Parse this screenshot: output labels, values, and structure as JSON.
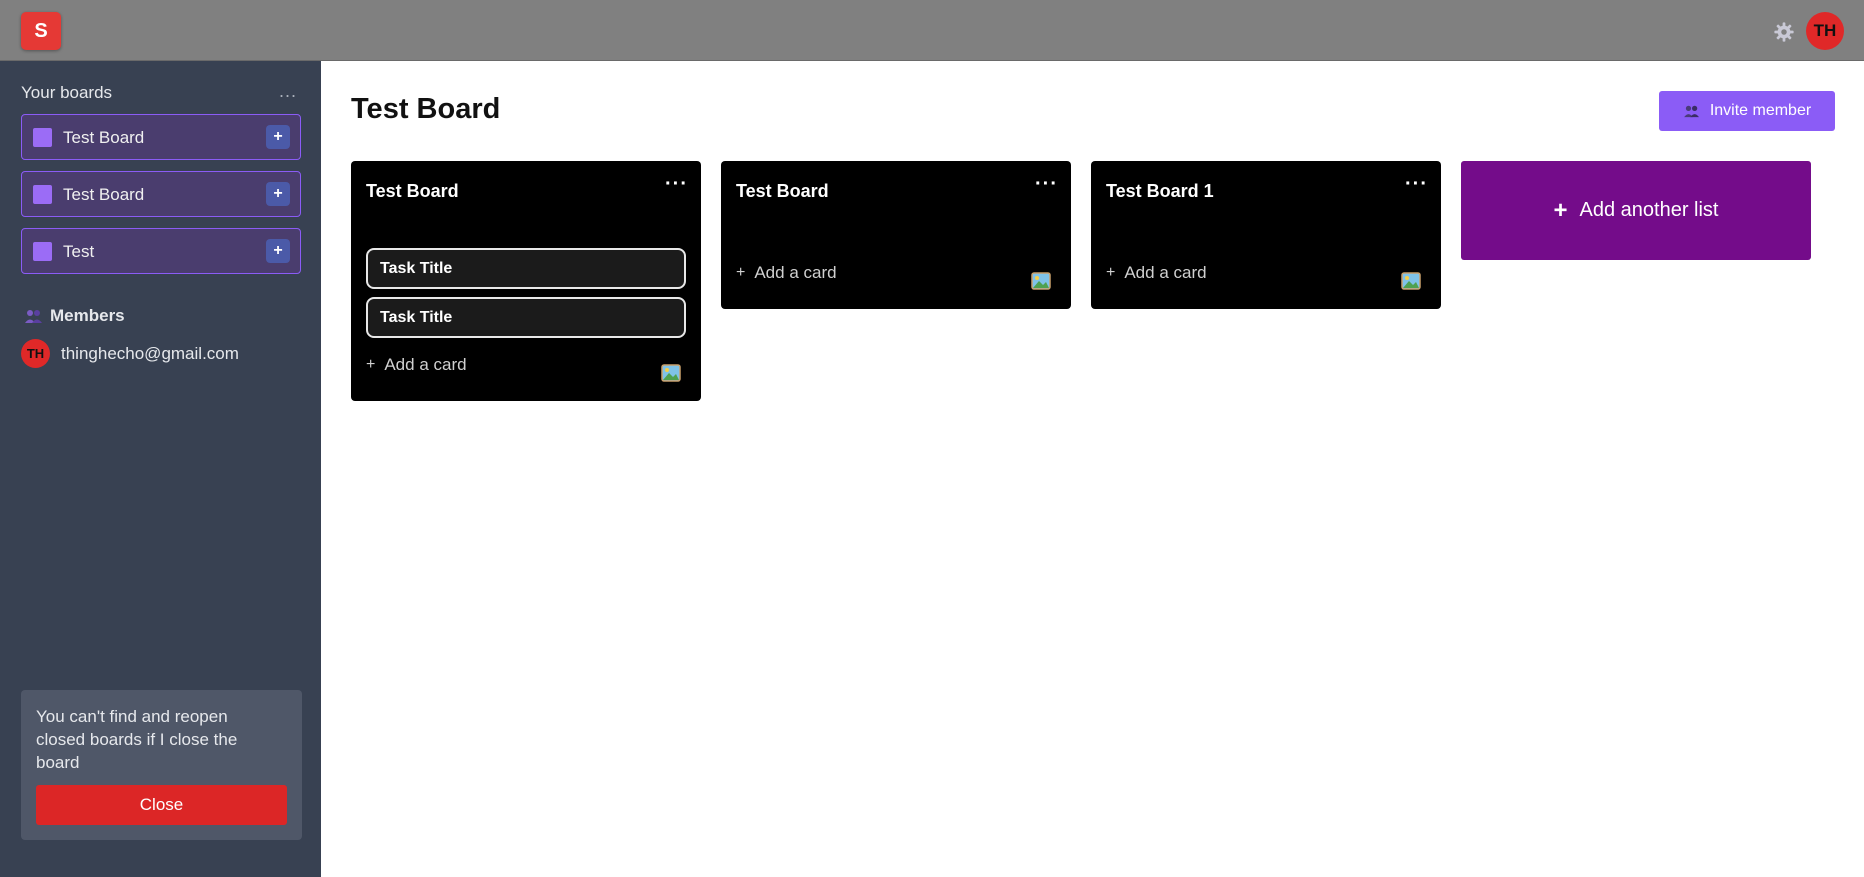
{
  "app": {
    "logo_letter": "S",
    "user_initials": "TH"
  },
  "sidebar": {
    "title": "Your boards",
    "more": "...",
    "boards": [
      {
        "label": "Test Board",
        "add": "+"
      },
      {
        "label": "Test Board",
        "add": "+"
      },
      {
        "label": "Test",
        "add": "+"
      }
    ],
    "members_title": "Members",
    "members": [
      {
        "initials": "TH",
        "email": "thinghecho@gmail.com"
      }
    ],
    "notice": {
      "text": "You can't find and reopen closed boards if I close the board",
      "button": "Close"
    }
  },
  "main": {
    "title": "Test Board",
    "invite_label": "Invite member",
    "lists": [
      {
        "title": "Test Board",
        "more": "···",
        "cards": [
          "Task Title",
          "Task Title"
        ],
        "add_card": "Add a card"
      },
      {
        "title": "Test Board",
        "more": "···",
        "cards": [],
        "add_card": "Add a card"
      },
      {
        "title": "Test Board 1",
        "more": "···",
        "cards": [],
        "add_card": "Add a card"
      }
    ],
    "add_list_label": "Add another list",
    "add_symbol": "+"
  },
  "icons": {
    "logo": "logo-icon",
    "settings": "gear-icon",
    "members": "members-icon",
    "invite": "members-icon",
    "card_image": "image-icon"
  },
  "colors": {
    "accent": "#8b5cf6",
    "danger": "#dc2626",
    "add_list": "#740c8a",
    "sidebar": "#384152"
  }
}
